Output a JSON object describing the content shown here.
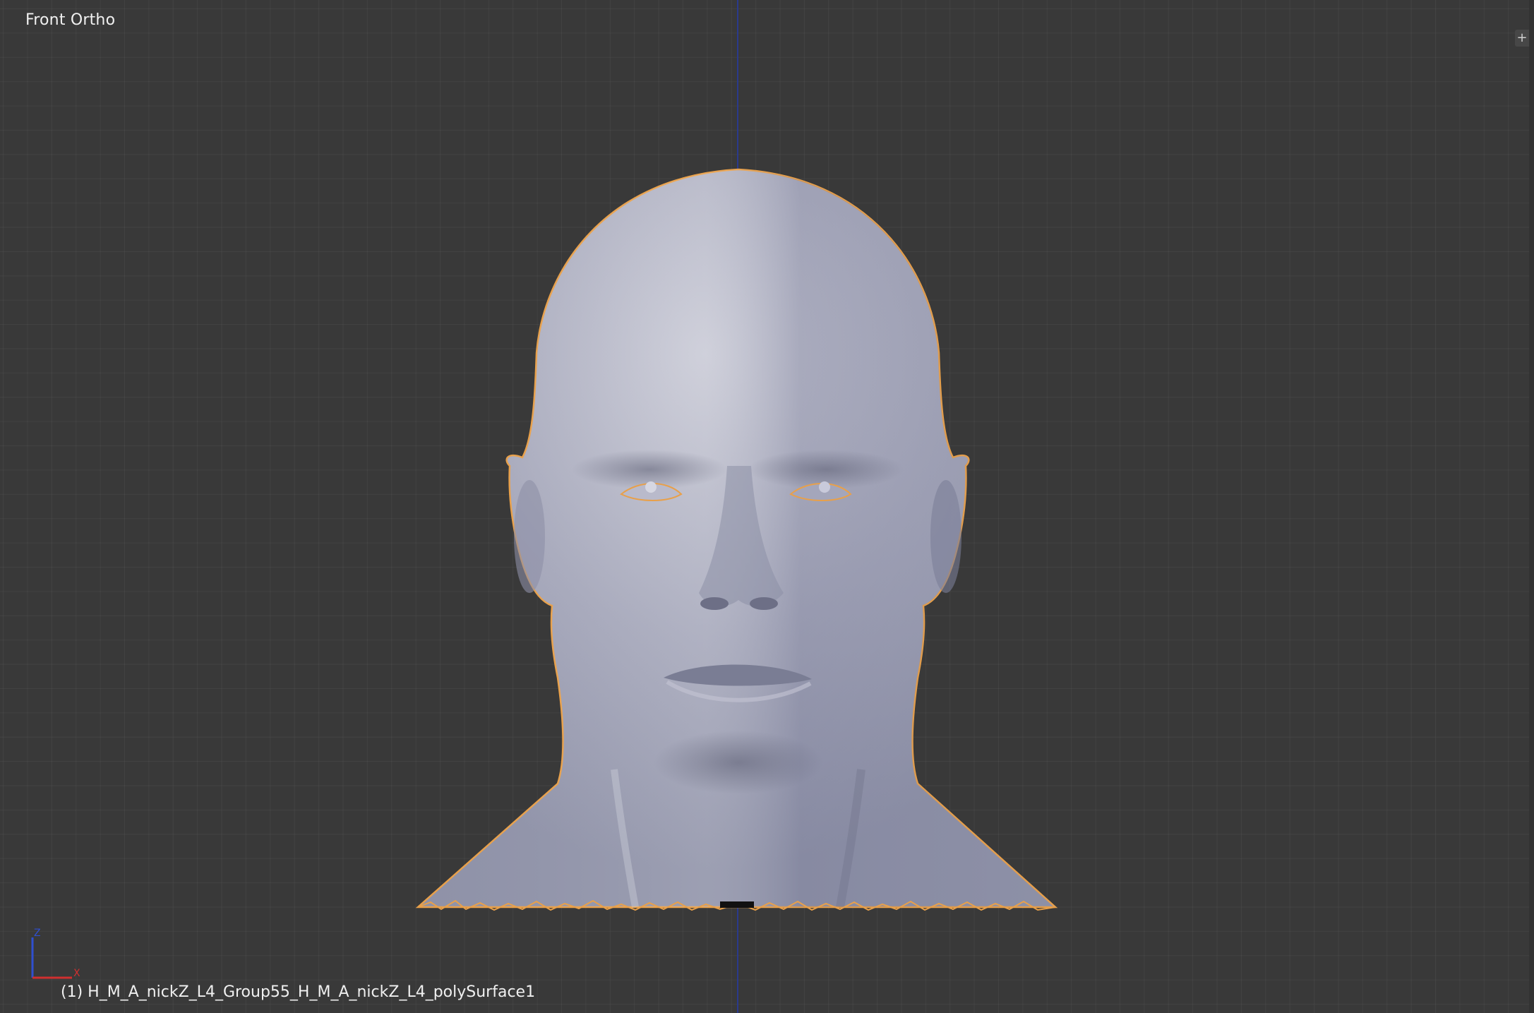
{
  "viewport": {
    "view_label": "Front Ortho",
    "object_label": "(1) H_M_A_nickZ_L4_Group55_H_M_A_nickZ_L4_polySurface1",
    "grid_color": "#464646",
    "background_color": "#393939",
    "selection_outline_color": "#e8a04a",
    "z_axis_color": "#2a3a8c"
  },
  "gizmo": {
    "z_label": "Z",
    "x_label": "X",
    "z_color": "#2f4fd0",
    "x_color": "#d02f2f"
  },
  "widgets": {
    "corner_icon": "plus-icon",
    "corner_symbol": "+"
  }
}
